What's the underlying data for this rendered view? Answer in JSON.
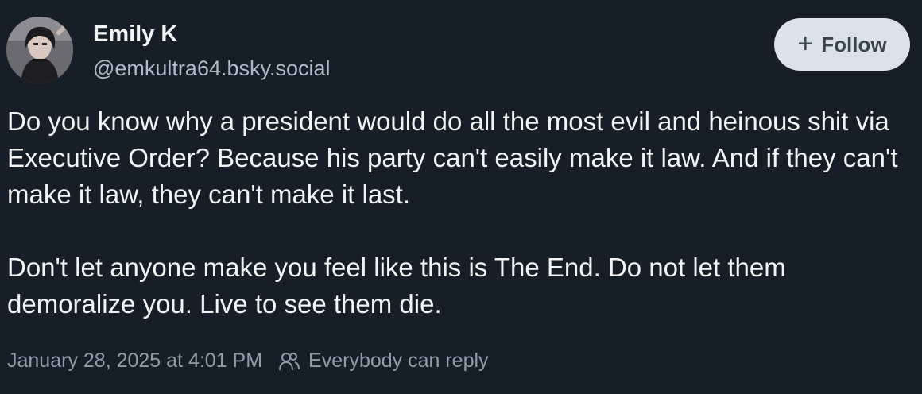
{
  "author": {
    "display_name": "Emily K",
    "handle": "@emkultra64.bsky.social",
    "avatar_icon": "profile-photo"
  },
  "follow_button": {
    "icon": "plus-icon",
    "icon_glyph": "+",
    "label": "Follow"
  },
  "post": {
    "paragraphs": [
      "Do you know why a president would do all the most evil and heinous shit via Executive Order? Because his party can't easily make it law. And if they can't make it law, they can't make it last.",
      "Don't let anyone make you feel like this is The End. Do not let them demoralize you. Live to see them die."
    ]
  },
  "meta": {
    "timestamp": "January 28, 2025 at 4:01 PM",
    "reply_icon": "people-icon",
    "reply_setting": "Everybody can reply"
  },
  "colors": {
    "background": "#161e27",
    "text": "#f1f3f5",
    "secondary_text": "#aebbc9",
    "button_bg": "#dce2ea",
    "button_text": "#3a4552"
  }
}
